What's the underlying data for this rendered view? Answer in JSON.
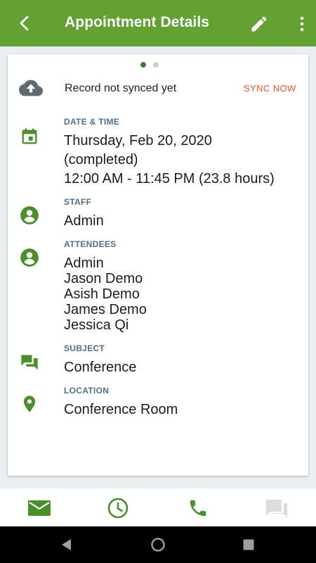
{
  "header": {
    "title": "Appointment Details"
  },
  "pager": {
    "count": 2,
    "active": 0
  },
  "sync": {
    "message": "Record not synced yet",
    "action": "SYNC NOW"
  },
  "details": {
    "datetime": {
      "label": "DATE & TIME",
      "line1": "Thursday, Feb 20, 2020",
      "line2": "(completed)",
      "line3": "12:00 AM - 11:45 PM (23.8 hours)"
    },
    "staff": {
      "label": "STAFF",
      "value": "Admin"
    },
    "attendees": {
      "label": "ATTENDEES",
      "names": [
        "Admin",
        "Jason Demo",
        "Asish Demo",
        "James Demo",
        "Jessica Qi"
      ]
    },
    "subject": {
      "label": "SUBJECT",
      "value": "Conference"
    },
    "location": {
      "label": "LOCATION",
      "value": "Conference Room"
    }
  },
  "icons": {
    "back": "chevron-left-icon",
    "edit": "pencil-icon",
    "more": "more-vert-icon",
    "sync": "cloud-upload-icon",
    "datetime": "calendar-icon",
    "staff": "account-circle-icon",
    "attendees": "account-circle-icon",
    "subject": "chat-bubbles-icon",
    "location": "map-pin-icon",
    "email": "email-icon",
    "clock": "clock-icon",
    "phone": "phone-icon",
    "messages": "chat-bubbles-icon"
  },
  "colors": {
    "brand_green": "#62a032",
    "icon_green": "#4a8f2b",
    "accent_orange": "#e8562a",
    "label_blue_grey": "#4e7186"
  }
}
